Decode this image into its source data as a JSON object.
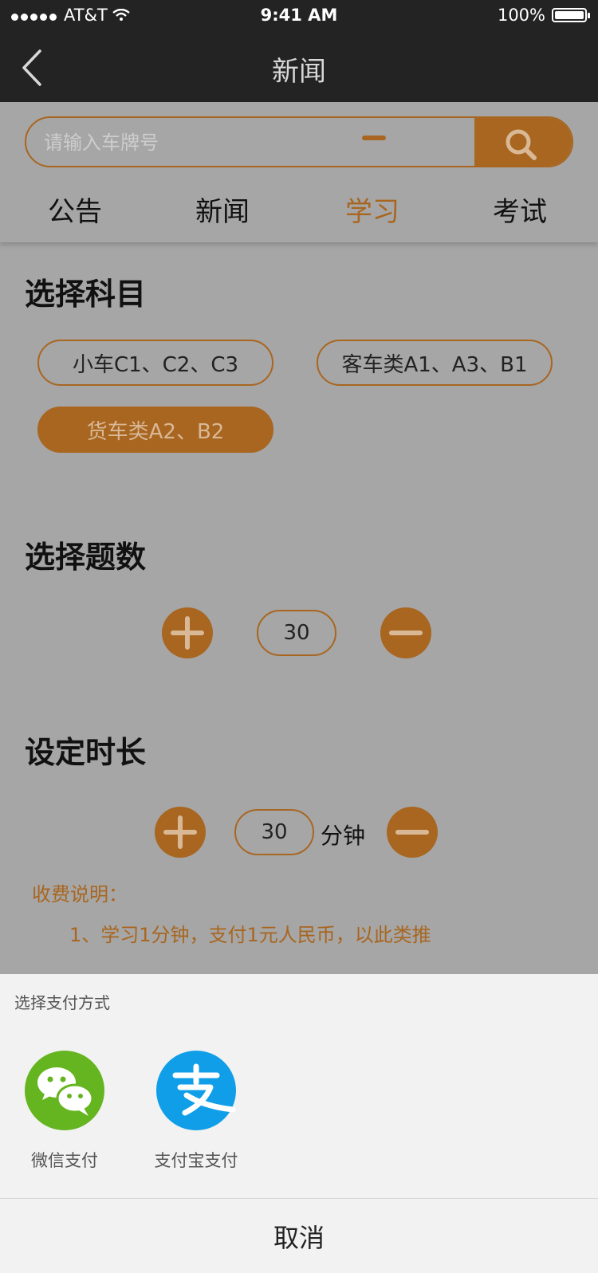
{
  "status_bar": {
    "carrier": "AT&T",
    "time": "9:41 AM",
    "battery": "100%"
  },
  "nav": {
    "title": "新闻"
  },
  "search": {
    "placeholder": "请输入车牌号"
  },
  "tabs": [
    {
      "label": "公告"
    },
    {
      "label": "新闻"
    },
    {
      "label": "学习",
      "active": true
    },
    {
      "label": "考试"
    }
  ],
  "subject": {
    "title": "选择科目",
    "options": [
      {
        "label": "小车C1、C2、C3"
      },
      {
        "label": "客车类A1、A3、B1"
      },
      {
        "label": "货车类A2、B2",
        "selected": true
      }
    ]
  },
  "question_count": {
    "title": "选择题数",
    "value": "30"
  },
  "duration": {
    "title": "设定时长",
    "value": "30",
    "unit": "分钟"
  },
  "fee": {
    "title": "收费说明：",
    "line1": "1、学习1分钟，支付1元人民币，以此类推"
  },
  "payment_sheet": {
    "title": "选择支付方式",
    "methods": [
      {
        "label": "微信支付",
        "icon": "wechat-icon",
        "color": "#65b521"
      },
      {
        "label": "支付宝支付",
        "icon": "alipay-icon",
        "color": "#109ee9"
      }
    ],
    "cancel_label": "取消"
  },
  "colors": {
    "accent": "#a86620",
    "overlay": "#a6a6a6",
    "nav_bg": "#232323"
  }
}
